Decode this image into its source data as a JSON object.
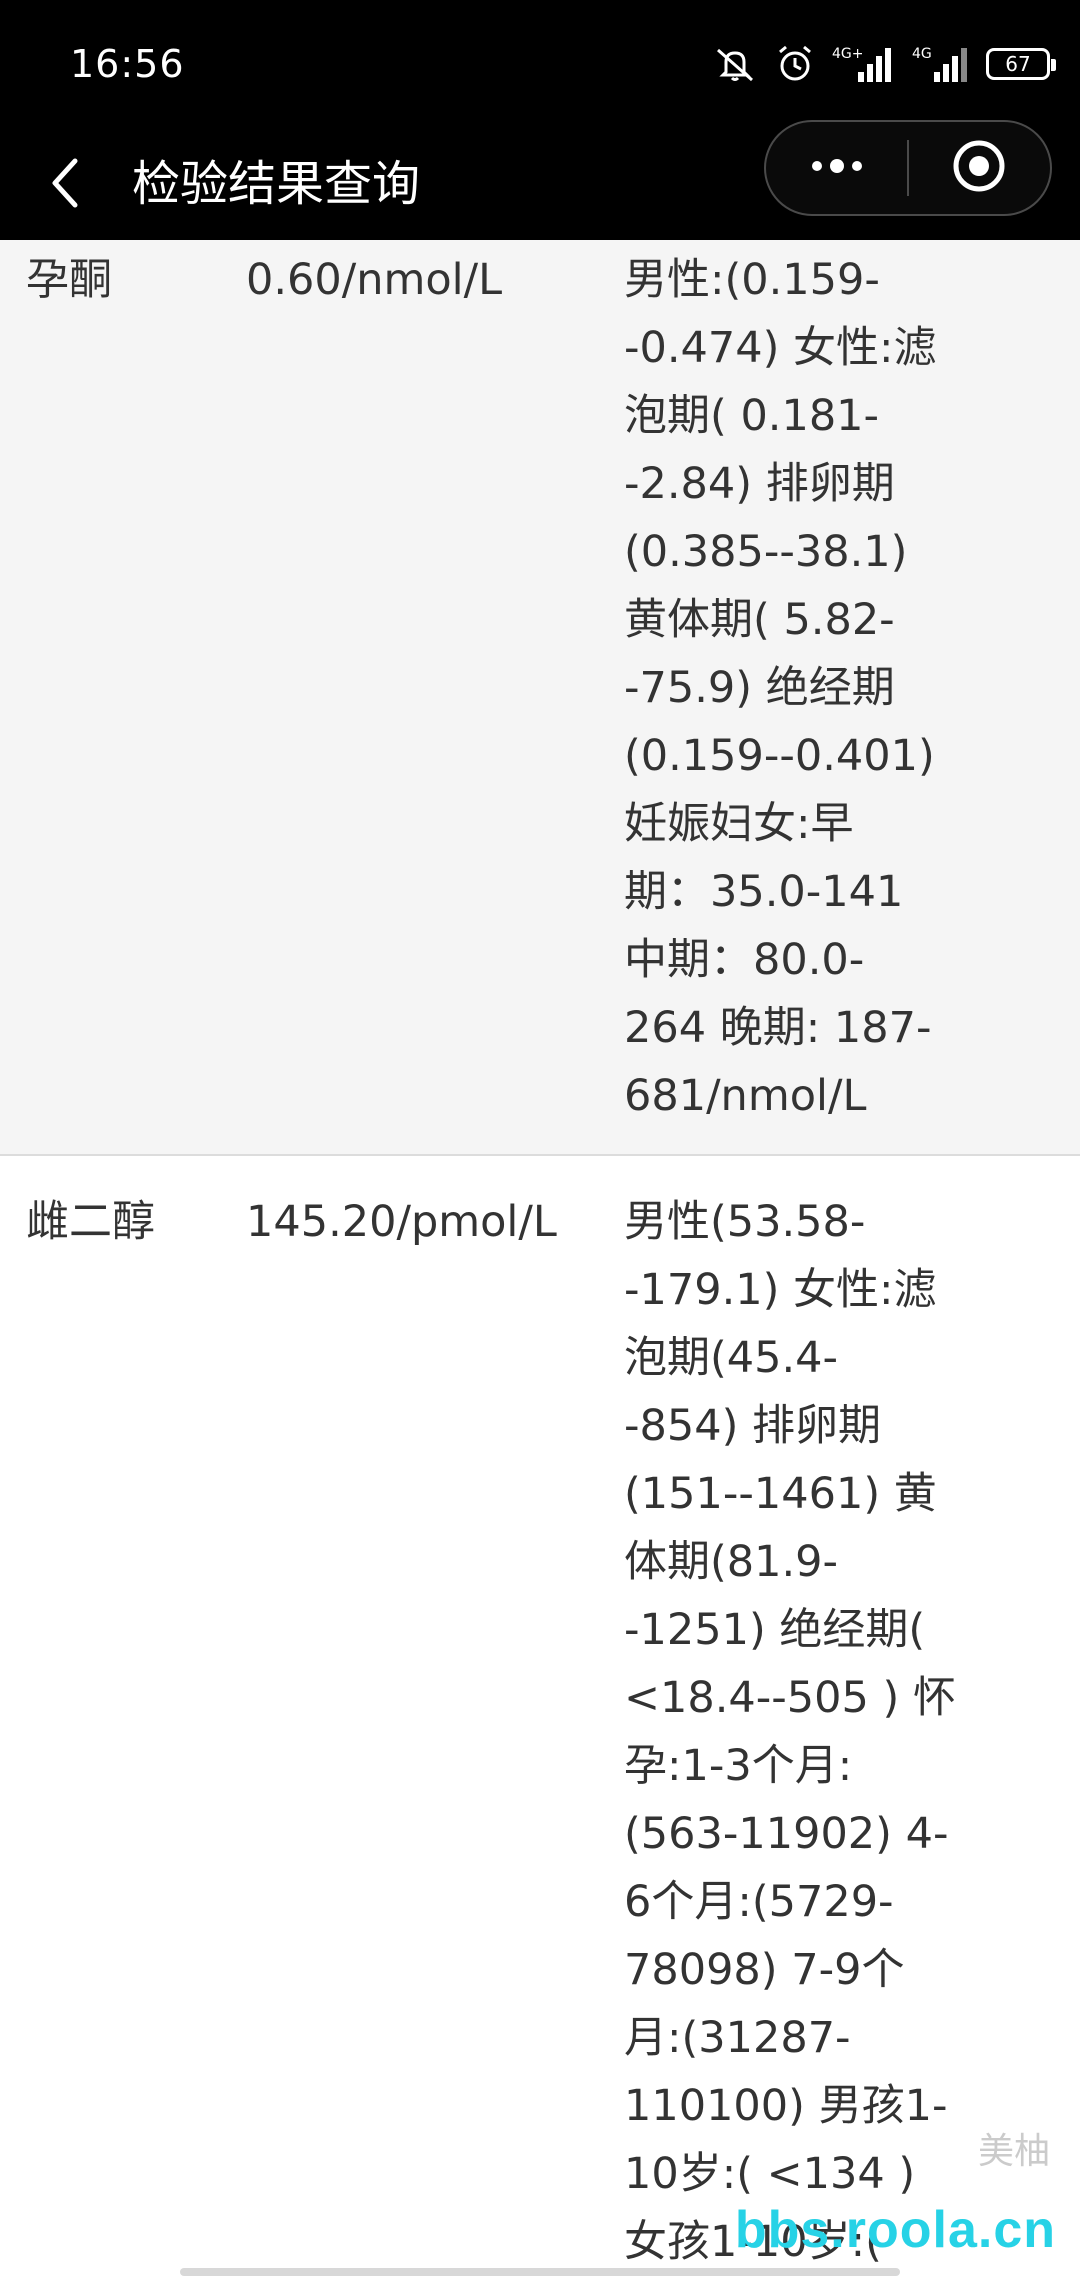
{
  "status_bar": {
    "time": "16:56",
    "icons": [
      "mute-icon",
      "alarm-icon",
      "signal-4g-plus-icon",
      "signal-4g-icon",
      "battery-icon"
    ],
    "signal_1_label": "4G+",
    "signal_2_label": "4G",
    "battery_level": "67"
  },
  "nav": {
    "title": "检验结果查询",
    "back_icon": "chevron-left-icon",
    "more_icon": "more-dots-icon",
    "close_icon": "target-circle-icon"
  },
  "results": [
    {
      "name": "孕酮",
      "value": "0.60/nmol/L",
      "range": "男性:(0.159-\n-0.474) 女性:滤\n泡期( 0.181-\n-2.84) 排卵期\n(0.385--38.1)\n黄体期( 5.82-\n-75.9) 绝经期\n(0.159--0.401)\n妊娠妇女:早\n期：35.0-141\n中期：80.0-\n264 晚期: 187-\n681/nmol/L"
    },
    {
      "name": "雌二醇",
      "value": "145.20/pmol/L",
      "range": "男性(53.58-\n-179.1) 女性:滤\n泡期(45.4-\n-854) 排卵期\n(151--1461) 黄\n体期(81.9-\n-1251) 绝经期(\n<18.4--505 ) 怀\n孕:1-3个月:\n(563-11902) 4-\n6个月:(5729-\n78098) 7-9个\n月:(31287-\n110100) 男孩1-\n10岁:( <134 )\n女孩1-10岁:("
    }
  ],
  "watermark": {
    "logo_text": "美柚",
    "text": "bbs.roola.cn"
  }
}
